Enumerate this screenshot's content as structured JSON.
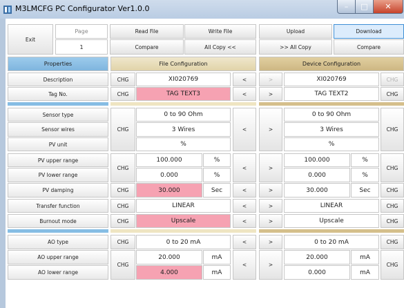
{
  "window": {
    "title": "M3LMCFG PC Configurator Ver1.0.0",
    "minimize_symbol": "–",
    "maximize_symbol": "□",
    "close_symbol": "✕"
  },
  "toolbar": {
    "exit": "Exit",
    "page_label": "Page",
    "page_value": "1",
    "read_file": "Read File",
    "write_file": "Write File",
    "upload": "Upload",
    "download": "Download",
    "compare_file": "Compare",
    "all_copy_left": "All Copy <<",
    "all_copy_right": ">> All Copy",
    "compare_device": "Compare"
  },
  "headers": {
    "properties": "Properties",
    "file": "File Configuration",
    "device": "Device Configuration"
  },
  "buttons": {
    "chg": "CHG",
    "copy_left": "<",
    "copy_right": ">"
  },
  "rows": {
    "description": {
      "label": "Description",
      "file": "XI020769",
      "device": "XI020769"
    },
    "tag_no": {
      "label": "Tag No.",
      "file": "TAG TEXT3",
      "device": "TAG TEXT2"
    },
    "sensor_type": {
      "label": "Sensor type",
      "file": "0 to 90 Ohm",
      "device": "0 to 90 Ohm"
    },
    "sensor_wires": {
      "label": "Sensor wires",
      "file": "3 Wires",
      "device": "3 Wires"
    },
    "pv_unit": {
      "label": "PV unit",
      "file": "%",
      "device": "%"
    },
    "pv_upper": {
      "label": "PV upper range",
      "file": "100.000",
      "file_unit": "%",
      "device": "100.000",
      "device_unit": "%"
    },
    "pv_lower": {
      "label": "PV lower range",
      "file": "0.000",
      "file_unit": "%",
      "device": "0.000",
      "device_unit": "%"
    },
    "pv_damping": {
      "label": "PV damping",
      "file": "30.000",
      "file_unit": "Sec",
      "device": "30.000",
      "device_unit": "Sec"
    },
    "transfer": {
      "label": "Transfer function",
      "file": "LINEAR",
      "device": "LINEAR"
    },
    "burnout": {
      "label": "Burnout mode",
      "file": "Upscale",
      "device": "Upscale"
    },
    "ao_type": {
      "label": "AO type",
      "file": "0 to 20 mA",
      "device": "0 to 20 mA"
    },
    "ao_upper": {
      "label": "AO upper range",
      "file": "20.000",
      "file_unit": "mA",
      "device": "20.000",
      "device_unit": "mA"
    },
    "ao_lower": {
      "label": "AO lower range",
      "file": "4.000",
      "file_unit": "mA",
      "device": "0.000",
      "device_unit": "mA"
    }
  },
  "colors": {
    "changed_highlight": "#f6a2b2",
    "properties_header": "#8fc2e6",
    "file_header": "#e8ddb9",
    "device_header": "#d6c291",
    "active_button": "#3f8fd5"
  }
}
